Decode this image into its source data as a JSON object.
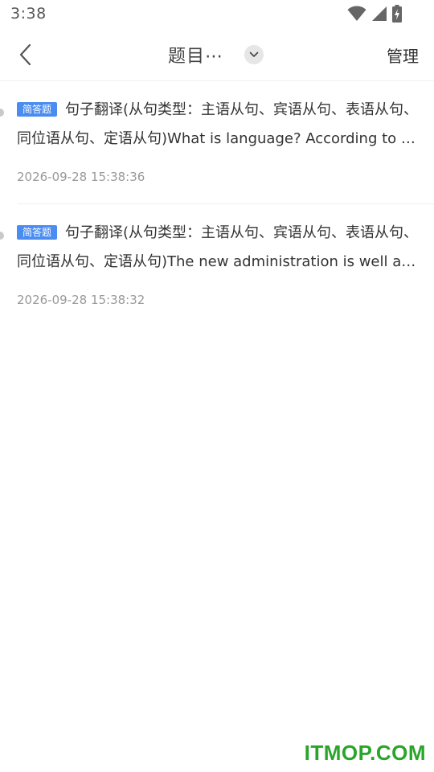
{
  "status_bar": {
    "time": "3:38",
    "icons": [
      "wifi-icon",
      "cell-signal-icon",
      "battery-charging-icon"
    ]
  },
  "header": {
    "title": "题目⋯",
    "manage_label": "管理"
  },
  "items": [
    {
      "badge": "简答题",
      "text": "句子翻译(从句类型：主语从句、宾语从句、表语从句、同位语从句、定语从句)What is language? According to linguists, language is a system of arbitrary vocal symbols.",
      "time": "2026-09-28 15:38:36"
    },
    {
      "badge": "简答题",
      "text": "句子翻译(从句类型：主语从句、宾语从句、表语从句、同位语从句、定语从句)The new administration is well aware that it will be judged.",
      "time": "2026-09-28 15:38:32"
    }
  ],
  "watermark": "ITMOP.COM",
  "colors": {
    "badge": "#4a8cf0",
    "watermark": "#2aa52a",
    "time_text": "#999999"
  }
}
